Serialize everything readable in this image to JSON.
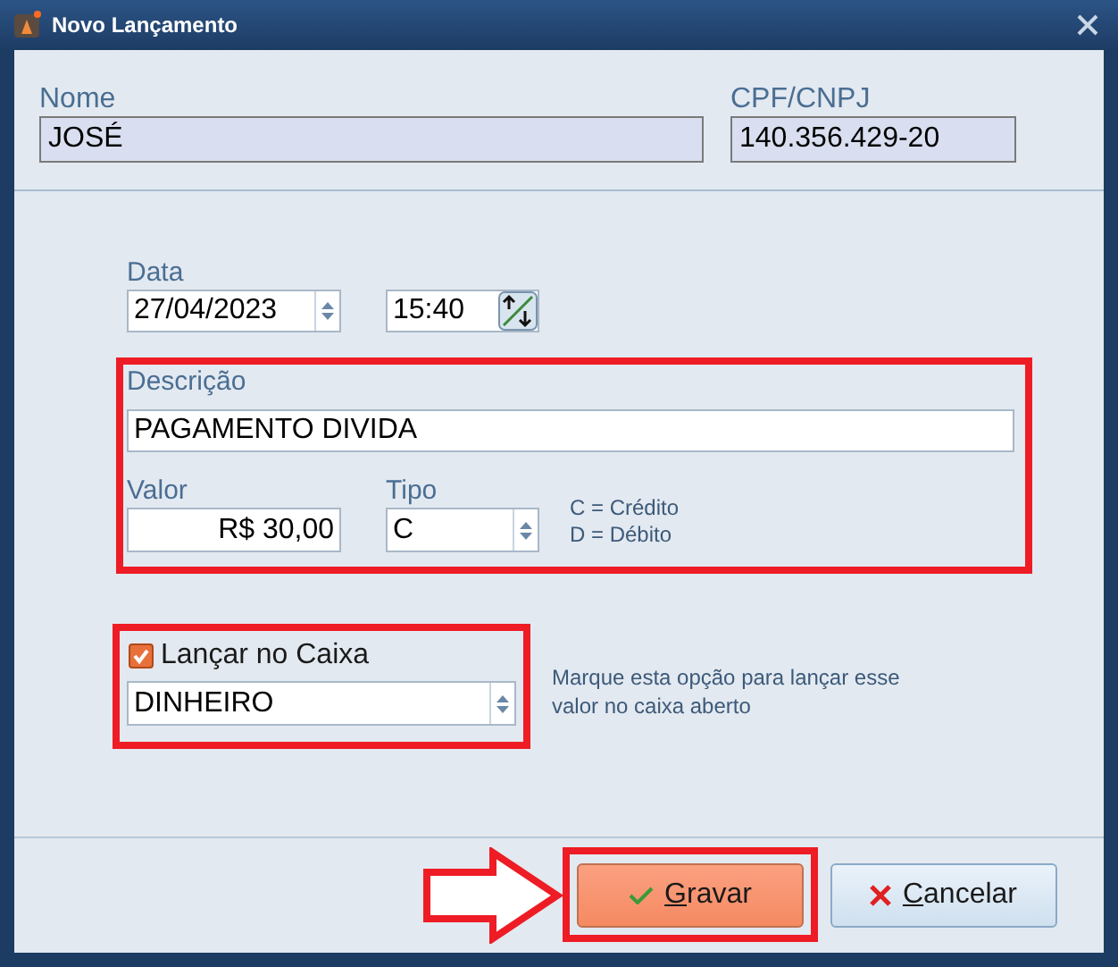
{
  "window": {
    "title": "Novo Lançamento"
  },
  "customer": {
    "name_label": "Nome",
    "name": "JOSÉ",
    "doc_label": "CPF/CNPJ",
    "doc": "140.356.429-20"
  },
  "date": {
    "label": "Data",
    "value": "27/04/2023",
    "time": "15:40"
  },
  "description": {
    "label": "Descrição",
    "value": "PAGAMENTO DIVIDA"
  },
  "amount": {
    "label": "Valor",
    "value": "R$ 30,00"
  },
  "type": {
    "label": "Tipo",
    "value": "C",
    "legend": [
      "C = Crédito",
      "D = Débito"
    ]
  },
  "cash": {
    "label": "Lançar no Caixa",
    "checked": true,
    "method": "DINHEIRO",
    "hint": "Marque esta opção para lançar esse valor no caixa aberto"
  },
  "buttons": [
    {
      "label": "Gravar",
      "kind": "save"
    },
    {
      "label": "Cancelar",
      "kind": "cancel"
    }
  ]
}
